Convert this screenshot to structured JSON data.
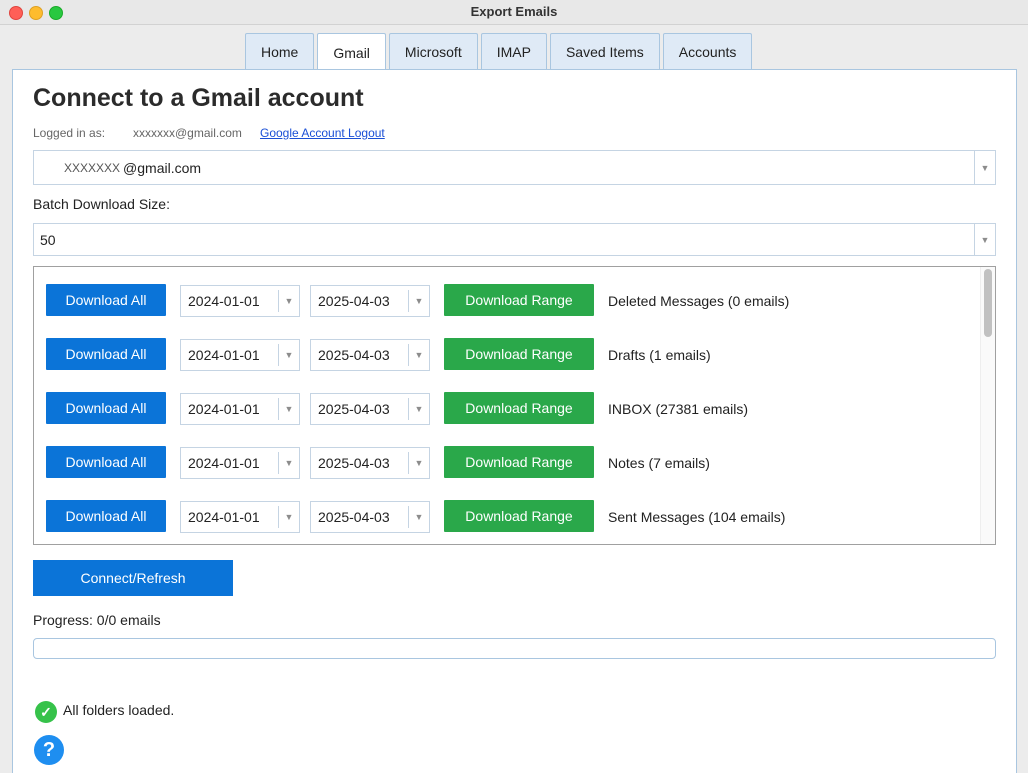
{
  "window": {
    "title": "Export Emails"
  },
  "tabs": [
    {
      "label": "Home"
    },
    {
      "label": "Gmail"
    },
    {
      "label": "Microsoft"
    },
    {
      "label": "IMAP"
    },
    {
      "label": "Saved Items"
    },
    {
      "label": "Accounts"
    }
  ],
  "active_tab": "Gmail",
  "header": {
    "title": "Connect to a Gmail account"
  },
  "login": {
    "label": "Logged in as:",
    "email": "xxxxxxx@gmail.com",
    "logout_link": "Google Account Logout"
  },
  "account_select": {
    "value_prefix": "XXXXXXX",
    "value_suffix": "@gmail.com"
  },
  "batch": {
    "label": "Batch Download Size:",
    "value": "50"
  },
  "folders": [
    {
      "download_all": "Download All",
      "start_date": "2024-01-01",
      "end_date": "2025-04-03",
      "download_range": "Download Range",
      "name": "Deleted Messages (0 emails)"
    },
    {
      "download_all": "Download All",
      "start_date": "2024-01-01",
      "end_date": "2025-04-03",
      "download_range": "Download Range",
      "name": "Drafts (1 emails)"
    },
    {
      "download_all": "Download All",
      "start_date": "2024-01-01",
      "end_date": "2025-04-03",
      "download_range": "Download Range",
      "name": "INBOX (27381 emails)"
    },
    {
      "download_all": "Download All",
      "start_date": "2024-01-01",
      "end_date": "2025-04-03",
      "download_range": "Download Range",
      "name": "Notes (7 emails)"
    },
    {
      "download_all": "Download All",
      "start_date": "2024-01-01",
      "end_date": "2025-04-03",
      "download_range": "Download Range",
      "name": "Sent Messages (104 emails)"
    }
  ],
  "connect_button": "Connect/Refresh",
  "progress": {
    "label": "Progress: 0/0 emails",
    "fraction": 0
  },
  "status": {
    "text": "All folders loaded.",
    "icon": "check-circle-icon"
  },
  "help": {
    "icon": "help-icon",
    "glyph": "?"
  },
  "colors": {
    "primary_blue": "#0b74d8",
    "action_green": "#2aa84a",
    "success_green": "#36c24a",
    "help_blue": "#1e8ef0",
    "link": "#1a4fd6"
  }
}
